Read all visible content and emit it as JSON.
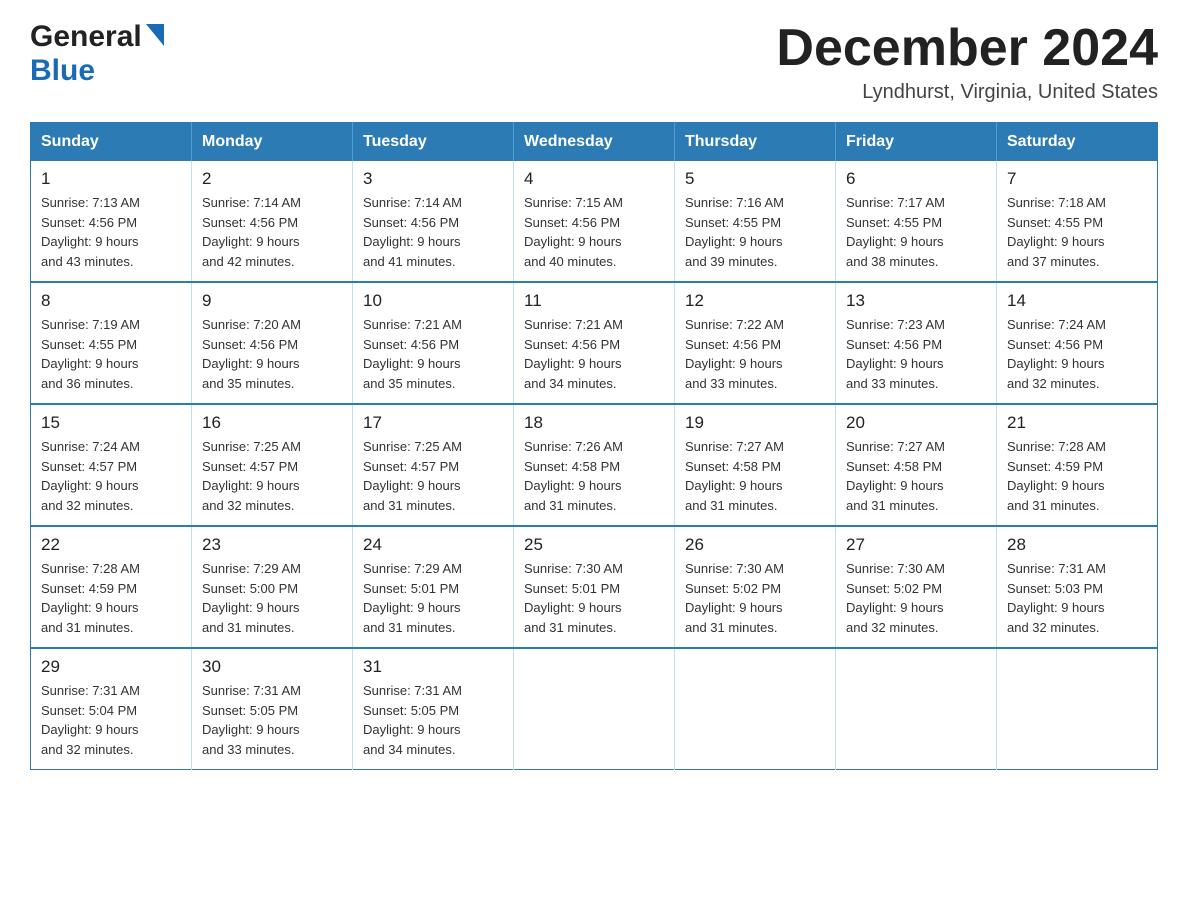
{
  "header": {
    "logo_general": "General",
    "logo_blue": "Blue",
    "month_title": "December 2024",
    "location": "Lyndhurst, Virginia, United States"
  },
  "weekdays": [
    "Sunday",
    "Monday",
    "Tuesday",
    "Wednesday",
    "Thursday",
    "Friday",
    "Saturday"
  ],
  "weeks": [
    [
      {
        "day": "1",
        "sunrise": "7:13 AM",
        "sunset": "4:56 PM",
        "daylight": "9 hours and 43 minutes."
      },
      {
        "day": "2",
        "sunrise": "7:14 AM",
        "sunset": "4:56 PM",
        "daylight": "9 hours and 42 minutes."
      },
      {
        "day": "3",
        "sunrise": "7:14 AM",
        "sunset": "4:56 PM",
        "daylight": "9 hours and 41 minutes."
      },
      {
        "day": "4",
        "sunrise": "7:15 AM",
        "sunset": "4:56 PM",
        "daylight": "9 hours and 40 minutes."
      },
      {
        "day": "5",
        "sunrise": "7:16 AM",
        "sunset": "4:55 PM",
        "daylight": "9 hours and 39 minutes."
      },
      {
        "day": "6",
        "sunrise": "7:17 AM",
        "sunset": "4:55 PM",
        "daylight": "9 hours and 38 minutes."
      },
      {
        "day": "7",
        "sunrise": "7:18 AM",
        "sunset": "4:55 PM",
        "daylight": "9 hours and 37 minutes."
      }
    ],
    [
      {
        "day": "8",
        "sunrise": "7:19 AM",
        "sunset": "4:55 PM",
        "daylight": "9 hours and 36 minutes."
      },
      {
        "day": "9",
        "sunrise": "7:20 AM",
        "sunset": "4:56 PM",
        "daylight": "9 hours and 35 minutes."
      },
      {
        "day": "10",
        "sunrise": "7:21 AM",
        "sunset": "4:56 PM",
        "daylight": "9 hours and 35 minutes."
      },
      {
        "day": "11",
        "sunrise": "7:21 AM",
        "sunset": "4:56 PM",
        "daylight": "9 hours and 34 minutes."
      },
      {
        "day": "12",
        "sunrise": "7:22 AM",
        "sunset": "4:56 PM",
        "daylight": "9 hours and 33 minutes."
      },
      {
        "day": "13",
        "sunrise": "7:23 AM",
        "sunset": "4:56 PM",
        "daylight": "9 hours and 33 minutes."
      },
      {
        "day": "14",
        "sunrise": "7:24 AM",
        "sunset": "4:56 PM",
        "daylight": "9 hours and 32 minutes."
      }
    ],
    [
      {
        "day": "15",
        "sunrise": "7:24 AM",
        "sunset": "4:57 PM",
        "daylight": "9 hours and 32 minutes."
      },
      {
        "day": "16",
        "sunrise": "7:25 AM",
        "sunset": "4:57 PM",
        "daylight": "9 hours and 32 minutes."
      },
      {
        "day": "17",
        "sunrise": "7:25 AM",
        "sunset": "4:57 PM",
        "daylight": "9 hours and 31 minutes."
      },
      {
        "day": "18",
        "sunrise": "7:26 AM",
        "sunset": "4:58 PM",
        "daylight": "9 hours and 31 minutes."
      },
      {
        "day": "19",
        "sunrise": "7:27 AM",
        "sunset": "4:58 PM",
        "daylight": "9 hours and 31 minutes."
      },
      {
        "day": "20",
        "sunrise": "7:27 AM",
        "sunset": "4:58 PM",
        "daylight": "9 hours and 31 minutes."
      },
      {
        "day": "21",
        "sunrise": "7:28 AM",
        "sunset": "4:59 PM",
        "daylight": "9 hours and 31 minutes."
      }
    ],
    [
      {
        "day": "22",
        "sunrise": "7:28 AM",
        "sunset": "4:59 PM",
        "daylight": "9 hours and 31 minutes."
      },
      {
        "day": "23",
        "sunrise": "7:29 AM",
        "sunset": "5:00 PM",
        "daylight": "9 hours and 31 minutes."
      },
      {
        "day": "24",
        "sunrise": "7:29 AM",
        "sunset": "5:01 PM",
        "daylight": "9 hours and 31 minutes."
      },
      {
        "day": "25",
        "sunrise": "7:30 AM",
        "sunset": "5:01 PM",
        "daylight": "9 hours and 31 minutes."
      },
      {
        "day": "26",
        "sunrise": "7:30 AM",
        "sunset": "5:02 PM",
        "daylight": "9 hours and 31 minutes."
      },
      {
        "day": "27",
        "sunrise": "7:30 AM",
        "sunset": "5:02 PM",
        "daylight": "9 hours and 32 minutes."
      },
      {
        "day": "28",
        "sunrise": "7:31 AM",
        "sunset": "5:03 PM",
        "daylight": "9 hours and 32 minutes."
      }
    ],
    [
      {
        "day": "29",
        "sunrise": "7:31 AM",
        "sunset": "5:04 PM",
        "daylight": "9 hours and 32 minutes."
      },
      {
        "day": "30",
        "sunrise": "7:31 AM",
        "sunset": "5:05 PM",
        "daylight": "9 hours and 33 minutes."
      },
      {
        "day": "31",
        "sunrise": "7:31 AM",
        "sunset": "5:05 PM",
        "daylight": "9 hours and 34 minutes."
      },
      null,
      null,
      null,
      null
    ]
  ],
  "labels": {
    "sunrise": "Sunrise:",
    "sunset": "Sunset:",
    "daylight": "Daylight:"
  }
}
